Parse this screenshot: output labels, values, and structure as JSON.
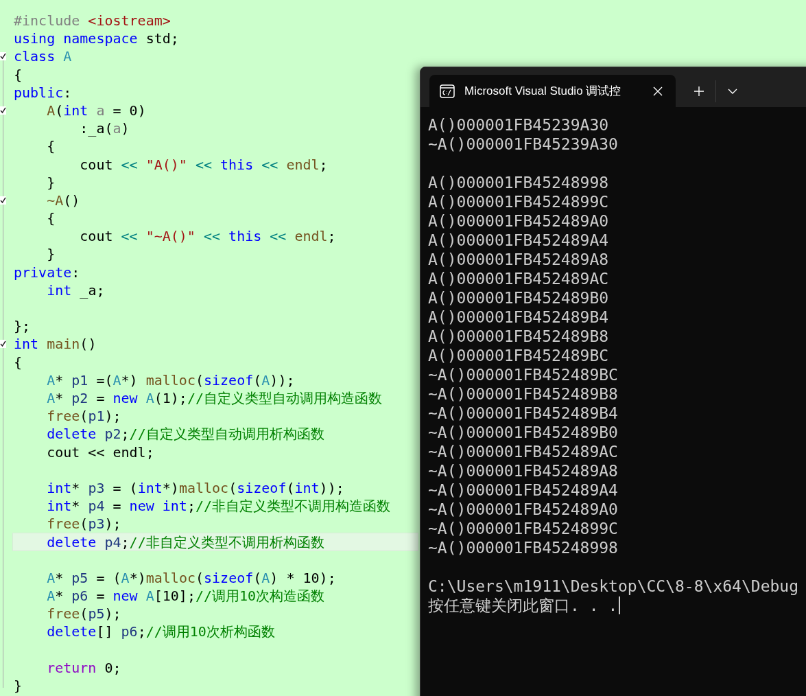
{
  "editor": {
    "lines": [
      {
        "kind": "code",
        "fold": false,
        "highlighted": false,
        "tokens": [
          {
            "kind": "pre",
            "text": "#include"
          },
          {
            "kind": "str",
            "text": " <iostream>"
          }
        ]
      },
      {
        "kind": "code",
        "fold": false,
        "highlighted": false,
        "tokens": [
          {
            "kind": "kw",
            "text": "using namespace"
          },
          {
            "kind": "plain",
            "text": " std;"
          }
        ]
      },
      {
        "kind": "code",
        "fold": true,
        "highlighted": false,
        "tokens": [
          {
            "kind": "kw",
            "text": "class"
          },
          {
            "kind": "type",
            "text": " A"
          }
        ]
      },
      {
        "kind": "code",
        "fold": false,
        "highlighted": false,
        "tokens": [
          {
            "kind": "plain",
            "text": "{"
          }
        ]
      },
      {
        "kind": "code",
        "fold": false,
        "highlighted": false,
        "tokens": [
          {
            "kind": "kw",
            "text": "public"
          },
          {
            "kind": "plain",
            "text": ":"
          }
        ]
      },
      {
        "kind": "code",
        "fold": true,
        "highlighted": false,
        "tokens": [
          {
            "kind": "fn",
            "text": "    A"
          },
          {
            "kind": "plain",
            "text": "("
          },
          {
            "kind": "kw",
            "text": "int"
          },
          {
            "kind": "param",
            "text": " a"
          },
          {
            "kind": "plain",
            "text": " = 0)"
          }
        ]
      },
      {
        "kind": "code",
        "fold": false,
        "highlighted": false,
        "tokens": [
          {
            "kind": "plain",
            "text": "        :_a("
          },
          {
            "kind": "param",
            "text": "a"
          },
          {
            "kind": "plain",
            "text": ")"
          }
        ]
      },
      {
        "kind": "code",
        "fold": false,
        "highlighted": false,
        "tokens": [
          {
            "kind": "plain",
            "text": "    {"
          }
        ]
      },
      {
        "kind": "code",
        "fold": false,
        "highlighted": false,
        "tokens": [
          {
            "kind": "plain",
            "text": "        cout"
          },
          {
            "kind": "op",
            "text": " <<"
          },
          {
            "kind": "str",
            "text": " \"A()\""
          },
          {
            "kind": "op",
            "text": " <<"
          },
          {
            "kind": "kw",
            "text": " this"
          },
          {
            "kind": "op",
            "text": " <<"
          },
          {
            "kind": "fn",
            "text": " endl"
          },
          {
            "kind": "plain",
            "text": ";"
          }
        ]
      },
      {
        "kind": "code",
        "fold": false,
        "highlighted": false,
        "tokens": [
          {
            "kind": "plain",
            "text": "    }"
          }
        ]
      },
      {
        "kind": "code",
        "fold": true,
        "highlighted": false,
        "tokens": [
          {
            "kind": "fn",
            "text": "    ~A"
          },
          {
            "kind": "plain",
            "text": "()"
          }
        ]
      },
      {
        "kind": "code",
        "fold": false,
        "highlighted": false,
        "tokens": [
          {
            "kind": "plain",
            "text": "    {"
          }
        ]
      },
      {
        "kind": "code",
        "fold": false,
        "highlighted": false,
        "tokens": [
          {
            "kind": "plain",
            "text": "        cout"
          },
          {
            "kind": "op",
            "text": " <<"
          },
          {
            "kind": "str",
            "text": " \"~A()\""
          },
          {
            "kind": "op",
            "text": " <<"
          },
          {
            "kind": "kw",
            "text": " this"
          },
          {
            "kind": "op",
            "text": " <<"
          },
          {
            "kind": "fn",
            "text": " endl"
          },
          {
            "kind": "plain",
            "text": ";"
          }
        ]
      },
      {
        "kind": "code",
        "fold": false,
        "highlighted": false,
        "tokens": [
          {
            "kind": "plain",
            "text": "    }"
          }
        ]
      },
      {
        "kind": "code",
        "fold": false,
        "highlighted": false,
        "tokens": [
          {
            "kind": "kw",
            "text": "private"
          },
          {
            "kind": "plain",
            "text": ":"
          }
        ]
      },
      {
        "kind": "code",
        "fold": false,
        "highlighted": false,
        "tokens": [
          {
            "kind": "kw",
            "text": "    int"
          },
          {
            "kind": "plain",
            "text": " _a;"
          }
        ]
      },
      {
        "kind": "blank"
      },
      {
        "kind": "code",
        "fold": false,
        "highlighted": false,
        "tokens": [
          {
            "kind": "plain",
            "text": "};"
          }
        ]
      },
      {
        "kind": "code",
        "fold": true,
        "highlighted": false,
        "tokens": [
          {
            "kind": "kw",
            "text": "int"
          },
          {
            "kind": "fn",
            "text": " main"
          },
          {
            "kind": "plain",
            "text": "()"
          }
        ]
      },
      {
        "kind": "code",
        "fold": false,
        "highlighted": false,
        "tokens": [
          {
            "kind": "plain",
            "text": "{"
          }
        ]
      },
      {
        "kind": "code",
        "fold": false,
        "highlighted": false,
        "tokens": [
          {
            "kind": "type",
            "text": "    A"
          },
          {
            "kind": "plain",
            "text": "* "
          },
          {
            "kind": "var",
            "text": "p1"
          },
          {
            "kind": "plain",
            "text": " =("
          },
          {
            "kind": "type",
            "text": "A"
          },
          {
            "kind": "plain",
            "text": "*) "
          },
          {
            "kind": "fn",
            "text": "malloc"
          },
          {
            "kind": "plain",
            "text": "("
          },
          {
            "kind": "kw",
            "text": "sizeof"
          },
          {
            "kind": "plain",
            "text": "("
          },
          {
            "kind": "type",
            "text": "A"
          },
          {
            "kind": "plain",
            "text": "));"
          }
        ]
      },
      {
        "kind": "code",
        "fold": false,
        "highlighted": false,
        "tokens": [
          {
            "kind": "type",
            "text": "    A"
          },
          {
            "kind": "plain",
            "text": "* "
          },
          {
            "kind": "var",
            "text": "p2"
          },
          {
            "kind": "plain",
            "text": " = "
          },
          {
            "kind": "kw",
            "text": "new"
          },
          {
            "kind": "type",
            "text": " A"
          },
          {
            "kind": "plain",
            "text": "(1);"
          },
          {
            "kind": "cmt",
            "text": "//自定义类型自动调用构造函数"
          }
        ]
      },
      {
        "kind": "code",
        "fold": false,
        "highlighted": false,
        "tokens": [
          {
            "kind": "fn",
            "text": "    free"
          },
          {
            "kind": "plain",
            "text": "("
          },
          {
            "kind": "var",
            "text": "p1"
          },
          {
            "kind": "plain",
            "text": ");"
          }
        ]
      },
      {
        "kind": "code",
        "fold": false,
        "highlighted": false,
        "tokens": [
          {
            "kind": "kw",
            "text": "    delete"
          },
          {
            "kind": "var",
            "text": " p2"
          },
          {
            "kind": "plain",
            "text": ";"
          },
          {
            "kind": "cmt",
            "text": "//自定义类型自动调用析构函数"
          }
        ]
      },
      {
        "kind": "code",
        "fold": false,
        "highlighted": false,
        "tokens": [
          {
            "kind": "plain",
            "text": "    cout << endl;"
          }
        ]
      },
      {
        "kind": "blank"
      },
      {
        "kind": "code",
        "fold": false,
        "highlighted": false,
        "tokens": [
          {
            "kind": "kw",
            "text": "    int"
          },
          {
            "kind": "plain",
            "text": "* "
          },
          {
            "kind": "var",
            "text": "p3"
          },
          {
            "kind": "plain",
            "text": " = ("
          },
          {
            "kind": "kw",
            "text": "int"
          },
          {
            "kind": "plain",
            "text": "*)"
          },
          {
            "kind": "fn",
            "text": "malloc"
          },
          {
            "kind": "plain",
            "text": "("
          },
          {
            "kind": "kw",
            "text": "sizeof"
          },
          {
            "kind": "plain",
            "text": "("
          },
          {
            "kind": "kw",
            "text": "int"
          },
          {
            "kind": "plain",
            "text": "));"
          }
        ]
      },
      {
        "kind": "code",
        "fold": false,
        "highlighted": false,
        "tokens": [
          {
            "kind": "kw",
            "text": "    int"
          },
          {
            "kind": "plain",
            "text": "* "
          },
          {
            "kind": "var",
            "text": "p4"
          },
          {
            "kind": "plain",
            "text": " = "
          },
          {
            "kind": "kw",
            "text": "new int"
          },
          {
            "kind": "plain",
            "text": ";"
          },
          {
            "kind": "cmt",
            "text": "//非自定义类型不调用构造函数"
          }
        ]
      },
      {
        "kind": "code",
        "fold": false,
        "highlighted": false,
        "tokens": [
          {
            "kind": "fn",
            "text": "    free"
          },
          {
            "kind": "plain",
            "text": "("
          },
          {
            "kind": "var",
            "text": "p3"
          },
          {
            "kind": "plain",
            "text": ");"
          }
        ]
      },
      {
        "kind": "code",
        "fold": false,
        "highlighted": true,
        "tokens": [
          {
            "kind": "kw",
            "text": "    delete"
          },
          {
            "kind": "var",
            "text": " p4"
          },
          {
            "kind": "plain",
            "text": ";"
          },
          {
            "kind": "cmt",
            "text": "//非自定义类型不调用析构函数"
          }
        ]
      },
      {
        "kind": "blank"
      },
      {
        "kind": "code",
        "fold": false,
        "highlighted": false,
        "tokens": [
          {
            "kind": "type",
            "text": "    A"
          },
          {
            "kind": "plain",
            "text": "* "
          },
          {
            "kind": "var",
            "text": "p5"
          },
          {
            "kind": "plain",
            "text": " = ("
          },
          {
            "kind": "type",
            "text": "A"
          },
          {
            "kind": "plain",
            "text": "*)"
          },
          {
            "kind": "fn",
            "text": "malloc"
          },
          {
            "kind": "plain",
            "text": "("
          },
          {
            "kind": "kw",
            "text": "sizeof"
          },
          {
            "kind": "plain",
            "text": "("
          },
          {
            "kind": "type",
            "text": "A"
          },
          {
            "kind": "plain",
            "text": ") * 10);"
          }
        ]
      },
      {
        "kind": "code",
        "fold": false,
        "highlighted": false,
        "tokens": [
          {
            "kind": "type",
            "text": "    A"
          },
          {
            "kind": "plain",
            "text": "* "
          },
          {
            "kind": "var",
            "text": "p6"
          },
          {
            "kind": "plain",
            "text": " = "
          },
          {
            "kind": "kw",
            "text": "new"
          },
          {
            "kind": "type",
            "text": " A"
          },
          {
            "kind": "plain",
            "text": "[10];"
          },
          {
            "kind": "cmt",
            "text": "//调用10次构造函数"
          }
        ]
      },
      {
        "kind": "code",
        "fold": false,
        "highlighted": false,
        "tokens": [
          {
            "kind": "fn",
            "text": "    free"
          },
          {
            "kind": "plain",
            "text": "("
          },
          {
            "kind": "var",
            "text": "p5"
          },
          {
            "kind": "plain",
            "text": ");"
          }
        ]
      },
      {
        "kind": "code",
        "fold": false,
        "highlighted": false,
        "tokens": [
          {
            "kind": "kw",
            "text": "    delete"
          },
          {
            "kind": "plain",
            "text": "[] "
          },
          {
            "kind": "var",
            "text": "p6"
          },
          {
            "kind": "plain",
            "text": ";"
          },
          {
            "kind": "cmt",
            "text": "//调用10次析构函数"
          }
        ]
      },
      {
        "kind": "blank"
      },
      {
        "kind": "code",
        "fold": false,
        "highlighted": false,
        "tokens": [
          {
            "kind": "ctl",
            "text": "    return"
          },
          {
            "kind": "plain",
            "text": " 0;"
          }
        ]
      },
      {
        "kind": "code",
        "fold": false,
        "highlighted": false,
        "tokens": [
          {
            "kind": "plain",
            "text": "}"
          }
        ]
      }
    ]
  },
  "terminal": {
    "tab": {
      "title": "Microsoft Visual Studio 调试控",
      "selected": true
    },
    "blocks": [
      {
        "lines": [
          "A()000001FB45239A30",
          "~A()000001FB45239A30"
        ]
      },
      {
        "lines": [
          "A()000001FB45248998",
          "A()000001FB4524899C",
          "A()000001FB452489A0",
          "A()000001FB452489A4",
          "A()000001FB452489A8",
          "A()000001FB452489AC",
          "A()000001FB452489B0",
          "A()000001FB452489B4",
          "A()000001FB452489B8",
          "A()000001FB452489BC",
          "~A()000001FB452489BC",
          "~A()000001FB452489B8",
          "~A()000001FB452489B4",
          "~A()000001FB452489B0",
          "~A()000001FB452489AC",
          "~A()000001FB452489A8",
          "~A()000001FB452489A4",
          "~A()000001FB452489A0",
          "~A()000001FB4524899C",
          "~A()000001FB45248998"
        ]
      },
      {
        "lines": [
          "C:\\Users\\m1911\\Desktop\\CC\\8-8\\x64\\Debug",
          "按任意键关闭此窗口. . ."
        ],
        "cursor": true
      }
    ]
  }
}
